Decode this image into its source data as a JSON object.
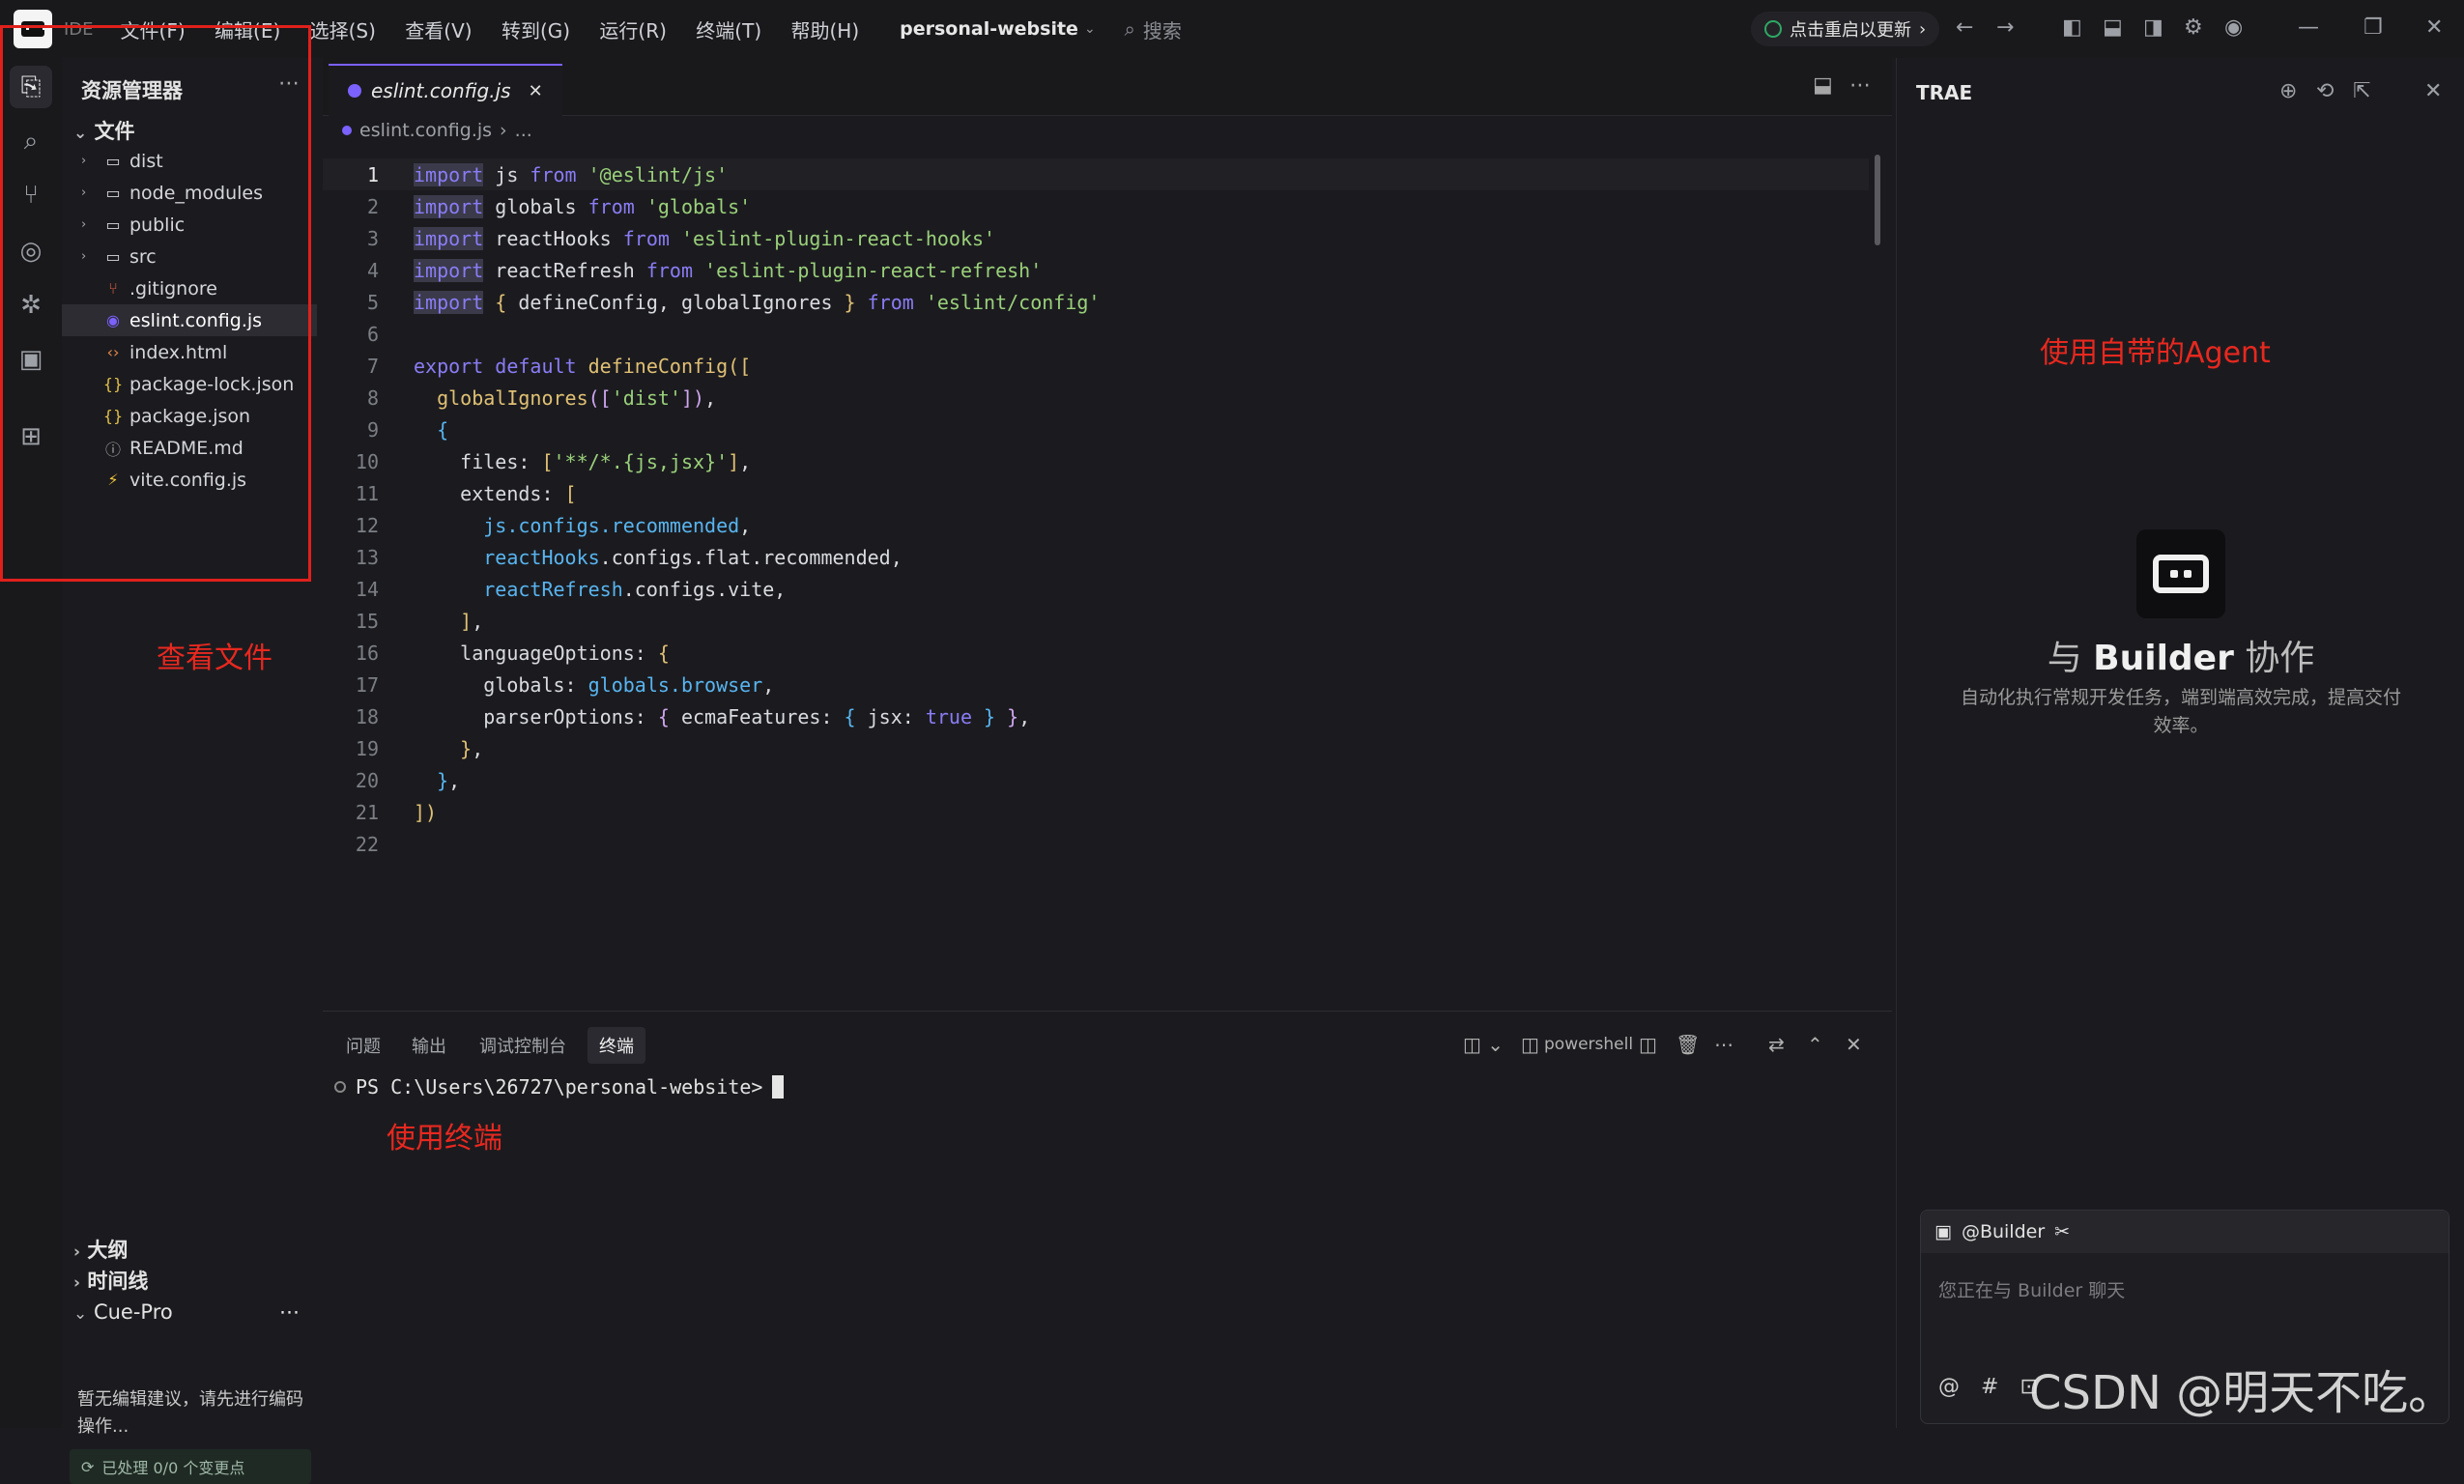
{
  "titlebar": {
    "ide_label": "IDE",
    "menus": [
      "文件(F)",
      "编辑(E)",
      "选择(S)",
      "查看(V)",
      "转到(G)",
      "运行(R)",
      "终端(T)",
      "帮助(H)"
    ],
    "project": "personal-website",
    "search_placeholder": "搜索",
    "update_label": "点击重启以更新"
  },
  "sidebar": {
    "title": "资源管理器",
    "section": "文件",
    "items": [
      {
        "label": "dist",
        "type": "folder"
      },
      {
        "label": "node_modules",
        "type": "folder"
      },
      {
        "label": "public",
        "type": "folder"
      },
      {
        "label": "src",
        "type": "folder"
      },
      {
        "label": ".gitignore",
        "type": "git"
      },
      {
        "label": "eslint.config.js",
        "type": "eslint",
        "selected": true
      },
      {
        "label": "index.html",
        "type": "html"
      },
      {
        "label": "package-lock.json",
        "type": "json"
      },
      {
        "label": "package.json",
        "type": "json"
      },
      {
        "label": "README.md",
        "type": "info"
      },
      {
        "label": "vite.config.js",
        "type": "vite"
      }
    ],
    "outline": "大纲",
    "timeline": "时间线",
    "cue_pro": "Cue-Pro",
    "cue_text": "暂无编辑建议，请先进行编码操作...",
    "cue_status": "已处理 0/0 个变更点"
  },
  "annotations": {
    "view_files": "查看文件",
    "use_terminal": "使用终端",
    "use_agent": "使用自带的Agent"
  },
  "editor": {
    "tab_label": "eslint.config.js",
    "breadcrumb_file": "eslint.config.js",
    "breadcrumb_more": "..."
  },
  "panel": {
    "tabs": [
      "问题",
      "输出",
      "调试控制台",
      "终端"
    ],
    "active_tab": "终端",
    "shell": "powershell",
    "prompt": "PS C:\\Users\\26727\\personal-website>"
  },
  "right_panel": {
    "title": "TRAE",
    "collab_prefix": "与",
    "collab_name": "Builder",
    "collab_suffix": "协作",
    "description": "自动化执行常规开发任务，端到端高效完成，提高交付效率。",
    "chat_mention": "@Builder",
    "chat_placeholder": "您正在与 Builder 聊天"
  },
  "watermark": "CSDN @明天不吃。"
}
